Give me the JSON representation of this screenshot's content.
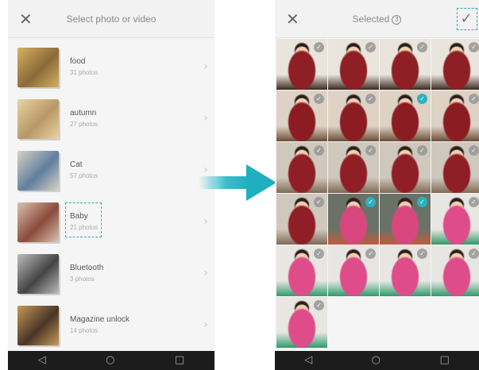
{
  "left_screen": {
    "close_glyph": "✕",
    "title": "Select photo or video",
    "albums": [
      {
        "name": "food",
        "count": "31 photos",
        "bg": "#8a6a3a",
        "accent": "#d6b060"
      },
      {
        "name": "autumn",
        "count": "27 photos",
        "bg": "#b89866",
        "accent": "#e8d3a4"
      },
      {
        "name": "Cat",
        "count": "57 photos",
        "bg": "#5f7f9f",
        "accent": "#d9d2c4"
      },
      {
        "name": "Baby",
        "count": "21 photos",
        "bg": "#8b4a3a",
        "accent": "#d9c3b0"
      },
      {
        "name": "Bluetooth",
        "count": "3 photos",
        "bg": "#444444",
        "accent": "#bdbdbd"
      },
      {
        "name": "Magazine unlock",
        "count": "14 photos",
        "bg": "#4a3526",
        "accent": "#c79a58"
      }
    ],
    "chevron_glyph": "›",
    "nav": {
      "back": "◁",
      "home": "○",
      "recent": "□"
    }
  },
  "right_screen": {
    "close_glyph": "✕",
    "title": "Selected",
    "selected_count": "3",
    "confirm_glyph": "✓",
    "check_glyph": "✓",
    "tiles": [
      {
        "scene": "red-dress-pose",
        "selected": false
      },
      {
        "scene": "red-dress-pose",
        "selected": false
      },
      {
        "scene": "red-dress-pose",
        "selected": false
      },
      {
        "scene": "red-dress-pose",
        "selected": false
      },
      {
        "scene": "red-dress-sit",
        "selected": false
      },
      {
        "scene": "red-dress-sit",
        "selected": false
      },
      {
        "scene": "red-dress-sit",
        "selected": true
      },
      {
        "scene": "red-dress-sit",
        "selected": false
      },
      {
        "scene": "red-dress-window",
        "selected": false
      },
      {
        "scene": "red-dress-window",
        "selected": false
      },
      {
        "scene": "red-dress-window",
        "selected": false
      },
      {
        "scene": "red-dress-window",
        "selected": false
      },
      {
        "scene": "red-dress-window",
        "selected": false
      },
      {
        "scene": "pink-shirt-toy",
        "selected": true
      },
      {
        "scene": "pink-shirt-toy",
        "selected": true
      },
      {
        "scene": "pink-shirt-stand",
        "selected": false
      },
      {
        "scene": "pink-shirt-stand",
        "selected": false
      },
      {
        "scene": "pink-shirt-stand",
        "selected": false
      },
      {
        "scene": "pink-shirt-stand",
        "selected": false
      },
      {
        "scene": "pink-shirt-stand",
        "selected": false
      },
      {
        "scene": "pink-shirt-stand",
        "selected": false
      }
    ],
    "nav": {
      "back": "◁",
      "home": "○",
      "recent": "□"
    }
  },
  "colors": {
    "accent": "#2bb3c0",
    "arrow": "#1fb0c0",
    "nav_bg": "#1c1c1c"
  }
}
